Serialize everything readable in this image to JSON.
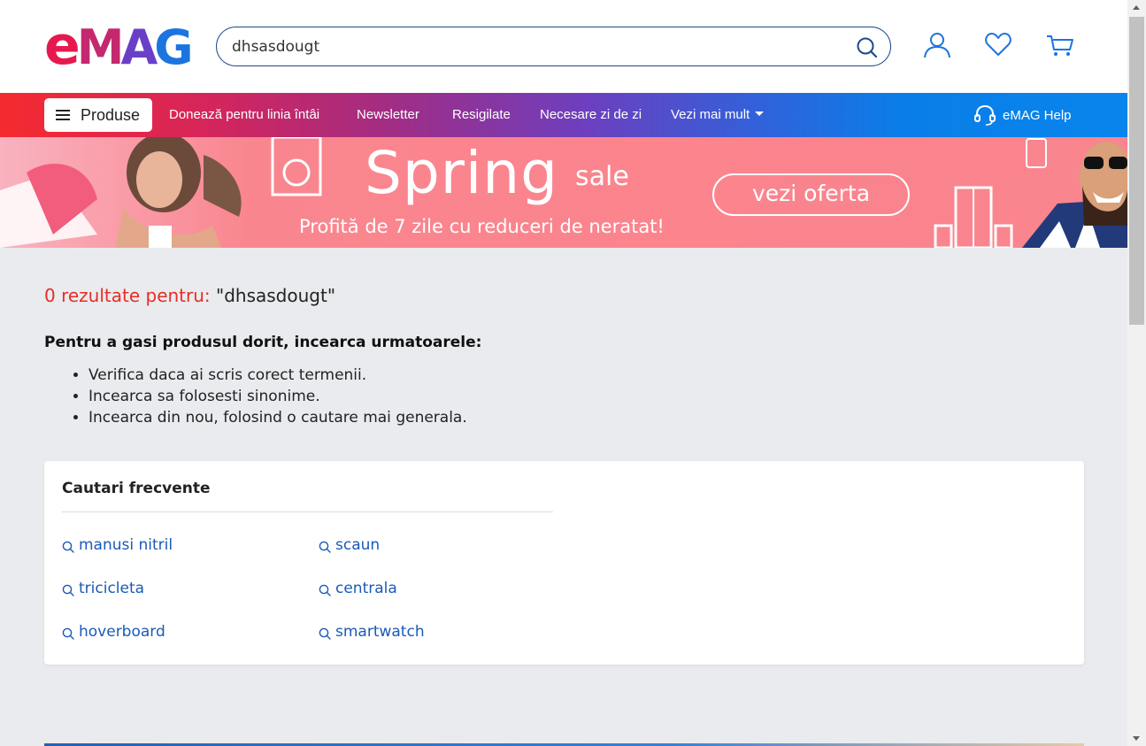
{
  "header": {
    "logo": "eMAG",
    "search": {
      "value": "dhsasdougt",
      "icon": "search-icon"
    },
    "icons": [
      "user-icon",
      "heart-icon",
      "cart-icon"
    ]
  },
  "nav": {
    "products_label": "Produse",
    "links": [
      "Donează pentru linia întâi",
      "Newsletter",
      "Resigilate",
      "Necesare zi de zi",
      "Vezi mai mult"
    ],
    "help_label": "eMAG Help"
  },
  "banner": {
    "title": "Spring",
    "title_suffix": "sale",
    "cta": "vezi oferta",
    "subtitle": "Profită de 7 zile cu reduceri de neratat!"
  },
  "results": {
    "count_text": "0 rezultate pentru:",
    "query_text": "\"dhsasdougt\""
  },
  "tips": {
    "title": "Pentru a gasi produsul dorit, incearca urmatoarele:",
    "items": [
      "Verifica daca ai scris corect termenii.",
      "Incearca sa folosesti sinonime.",
      "Incearca din nou, folosind o cautare mai generala."
    ]
  },
  "frequent": {
    "title": "Cautari frecvente",
    "terms": [
      "manusi nitril",
      "scaun",
      "tricicleta",
      "centrala",
      "hoverboard",
      "smartwatch"
    ]
  },
  "colors": {
    "brand_blue": "#1c74e0",
    "brand_red": "#e6194f",
    "result_count_red": "#e52e25",
    "link_blue": "#1a5ab7"
  }
}
